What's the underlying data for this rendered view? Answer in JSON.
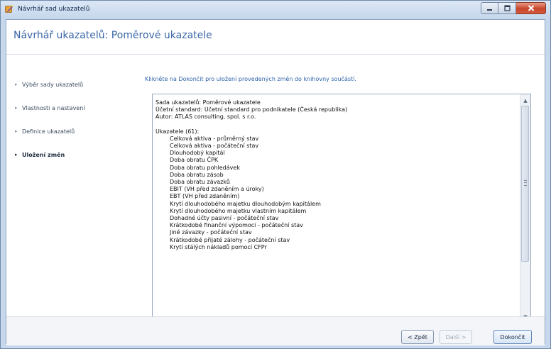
{
  "window": {
    "title": "Návrhář sad ukazatelů"
  },
  "page": {
    "title": "Návrhář ukazatelů: Poměrové ukazatele"
  },
  "nav": {
    "items": [
      {
        "label": "Výběr sady ukazatelů",
        "active": false
      },
      {
        "label": "Vlastnosti a nastavení",
        "active": false
      },
      {
        "label": "Definice ukazatelů",
        "active": false
      },
      {
        "label": "Uložení změn",
        "active": true
      }
    ]
  },
  "instruction": "Klikněte na Dokončit pro uložení provedených změn do knihovny součástí.",
  "summary": {
    "set_line": "Sada ukazatelů: Poměrové ukazatele",
    "standard_line": "Účetní standard: Účetní standard pro podnikatele (Česká republika)",
    "author_line": "Autor: ATLAS consulting, spol. s r.o.",
    "indicators_header": "Ukazatele (61):",
    "indicators": [
      "Celková aktiva - průměrný stav",
      "Celková aktiva - počáteční stav",
      "Dlouhodobý kapitál",
      "Doba obratu ČPK",
      "Doba obratu pohledávek",
      "Doba obratu zásob",
      "Doba obratu závazků",
      "EBIT (VH před zdaněním a úroky)",
      "EBT (VH před zdaněním)",
      "Krytí dlouhodobého majetku dlouhodobým kapitálem",
      "Krytí dlouhodobého majetku vlastním kapitálem",
      "Dohadné účty pasivní - počáteční stav",
      "Krátkodobé finanční výpomoci - počáteční stav",
      "Jiné závazky - počáteční stav",
      "Krátkodobé přijaté zálohy - počáteční stav",
      "Krytí stálých nákladů pomocí CFPr"
    ]
  },
  "buttons": {
    "back": "< Zpět",
    "next": "Další >",
    "finish": "Dokončit"
  },
  "icons": {
    "app": "wizard-app-icon",
    "minimize": "minimize-icon",
    "maximize": "maximize-icon",
    "close": "close-icon",
    "scroll_up": "scroll-up-arrow-icon",
    "scroll_down": "scroll-down-arrow-icon"
  }
}
